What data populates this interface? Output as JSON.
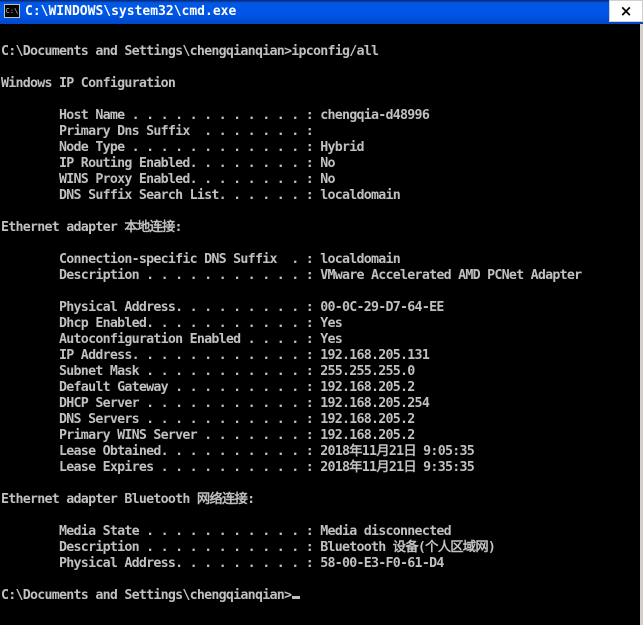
{
  "window": {
    "title": "C:\\WINDOWS\\system32\\cmd.exe",
    "icon_text": "C:\\",
    "close_label": "×"
  },
  "console": {
    "lines": [
      "",
      "C:\\Documents and Settings\\chengqianqian>ipconfig/all",
      "",
      "Windows IP Configuration",
      "",
      "        Host Name . . . . . . . . . . . . : chengqia-d48996",
      "        Primary Dns Suffix  . . . . . . . :",
      "        Node Type . . . . . . . . . . . . : Hybrid",
      "        IP Routing Enabled. . . . . . . . : No",
      "        WINS Proxy Enabled. . . . . . . . : No",
      "        DNS Suffix Search List. . . . . . : localdomain",
      "",
      "Ethernet adapter 本地连接:",
      "",
      "        Connection-specific DNS Suffix  . : localdomain",
      "        Description . . . . . . . . . . . : VMware Accelerated AMD PCNet Adapter",
      "",
      "        Physical Address. . . . . . . . . : 00-0C-29-D7-64-EE",
      "        Dhcp Enabled. . . . . . . . . . . : Yes",
      "        Autoconfiguration Enabled . . . . : Yes",
      "        IP Address. . . . . . . . . . . . : 192.168.205.131",
      "        Subnet Mask . . . . . . . . . . . : 255.255.255.0",
      "        Default Gateway . . . . . . . . . : 192.168.205.2",
      "        DHCP Server . . . . . . . . . . . : 192.168.205.254",
      "        DNS Servers . . . . . . . . . . . : 192.168.205.2",
      "        Primary WINS Server . . . . . . . : 192.168.205.2",
      "        Lease Obtained. . . . . . . . . . : 2018年11月21日 9:05:35",
      "        Lease Expires . . . . . . . . . . : 2018年11月21日 9:35:35",
      "",
      "Ethernet adapter Bluetooth 网络连接:",
      "",
      "        Media State . . . . . . . . . . . : Media disconnected",
      "        Description . . . . . . . . . . . : Bluetooth 设备(个人区域网)",
      "        Physical Address. . . . . . . . . : 58-00-E3-F0-61-D4",
      "",
      "C:\\Documents and Settings\\chengqianqian>"
    ]
  },
  "colors": {
    "console_bg": "#000000",
    "console_fg": "#c0c0c0",
    "titlebar": "#0055e5"
  }
}
